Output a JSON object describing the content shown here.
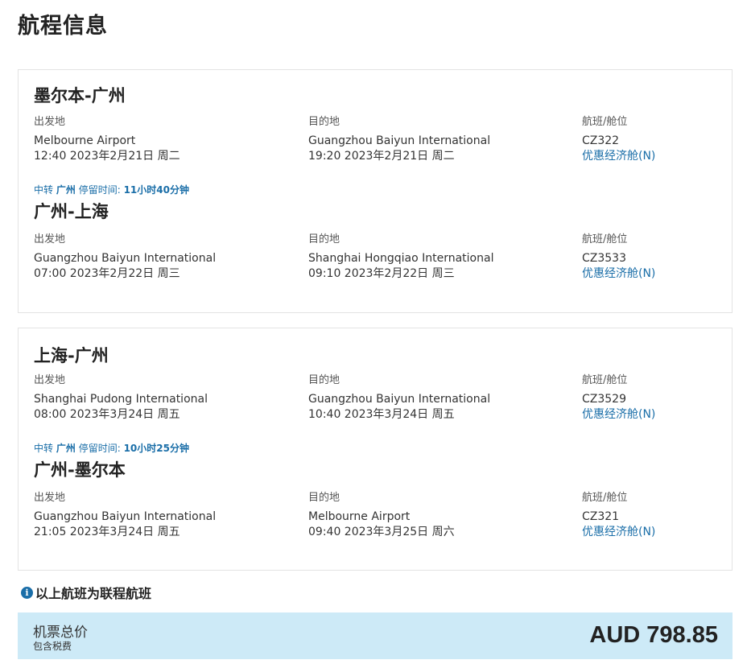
{
  "page_title": "航程信息",
  "legs": [
    {
      "segments": [
        {
          "route": "墨尔本-广州",
          "from_label": "出发地",
          "from_airport": "Melbourne Airport",
          "from_time": "12:40 2023年2月21日 周二",
          "to_label": "目的地",
          "to_airport": "Guangzhou Baiyun International",
          "to_time": "19:20 2023年2月21日 周二",
          "flight_label": "航班/舱位",
          "flight_no": "CZ322",
          "cabin": "优惠经济舱(N)"
        },
        {
          "route": "广州-上海",
          "from_label": "出发地",
          "from_airport": "Guangzhou Baiyun International",
          "from_time": "07:00 2023年2月22日 周三",
          "to_label": "目的地",
          "to_airport": "Shanghai Hongqiao International",
          "to_time": "09:10 2023年2月22日 周三",
          "flight_label": "航班/舱位",
          "flight_no": "CZ3533",
          "cabin": "优惠经济舱(N)"
        }
      ],
      "transfer": {
        "prefix": "中转",
        "city": "广州",
        "stay_label": "停留时间:",
        "duration": "11小时40分钟"
      }
    },
    {
      "segments": [
        {
          "route": "上海-广州",
          "from_label": "出发地",
          "from_airport": "Shanghai Pudong International",
          "from_time": "08:00 2023年3月24日 周五",
          "to_label": "目的地",
          "to_airport": "Guangzhou Baiyun International",
          "to_time": "10:40 2023年3月24日 周五",
          "flight_label": "航班/舱位",
          "flight_no": "CZ3529",
          "cabin": "优惠经济舱(N)"
        },
        {
          "route": "广州-墨尔本",
          "from_label": "出发地",
          "from_airport": "Guangzhou Baiyun International",
          "from_time": "21:05 2023年3月24日 周五",
          "to_label": "目的地",
          "to_airport": "Melbourne Airport",
          "to_time": "09:40 2023年3月25日 周六",
          "flight_label": "航班/舱位",
          "flight_no": "CZ321",
          "cabin": "优惠经济舱(N)"
        }
      ],
      "transfer": {
        "prefix": "中转",
        "city": "广州",
        "stay_label": "停留时间:",
        "duration": "10小时25分钟"
      }
    }
  ],
  "notice": {
    "icon": "info-icon",
    "icon_glyph": "i",
    "text": "以上航班为联程航班"
  },
  "price": {
    "label": "机票总价",
    "sub_label": "包含税费",
    "amount": "AUD 798.85"
  },
  "colors": {
    "accent": "#1a6ea8",
    "price_bar_bg": "#cdeaf7",
    "card_border": "#e3e3e3"
  }
}
